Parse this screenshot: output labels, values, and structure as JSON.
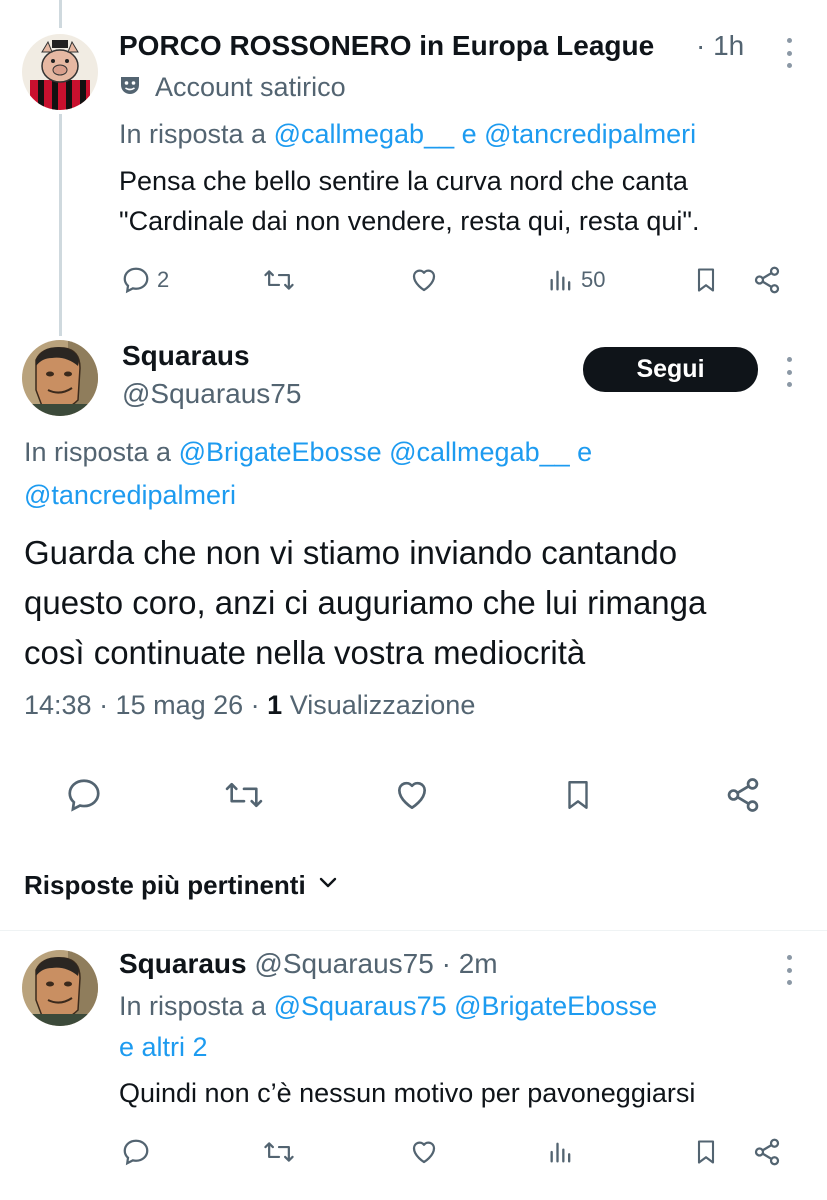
{
  "tweet1": {
    "name": "PORCO ROSSONERO in Europa League",
    "time": "· 1h",
    "label_text": "Account satirico",
    "reply_prefix": "In risposta a",
    "reply_mention1": "@callmegab__",
    "reply_and": "e",
    "reply_mention2": "@tancredipalmeri",
    "text_line1": "Pensa che bello sentire la curva nord che canta",
    "text_line2": "\"Cardinale dai non vendere, resta qui, resta qui\".",
    "replies": "2",
    "views": "50",
    "icons": [
      "reply-icon",
      "retweet-icon",
      "like-icon",
      "views-icon",
      "bookmark-icon",
      "share-icon"
    ]
  },
  "tweet2": {
    "name": "Squaraus",
    "handle": "@Squaraus75",
    "follow_label": "Segui",
    "reply_prefix": "In risposta a",
    "reply_mention1": "@BrigateEbosse",
    "reply_mention2": "@callmegab__",
    "reply_and": "e",
    "reply_mention3": "@tancredipalmeri",
    "text_line1": "Guarda che non vi stiamo inviando cantando",
    "text_line2": "questo coro, anzi ci auguriamo che lui rimanga",
    "text_line3": "così continuate nella vostra mediocrità",
    "meta_time": "14:38 · 15 mag 26 ·",
    "meta_count": "1",
    "meta_label": "Visualizzazione"
  },
  "sort": {
    "label": "Risposte più pertinenti"
  },
  "tweet3": {
    "name": "Squaraus",
    "handle": "@Squaraus75",
    "time": "· 2m",
    "reply_prefix": "In risposta a",
    "reply_mention1": "@Squaraus75",
    "reply_mention2": "@BrigateEbosse",
    "reply_and_others": "e altri 2",
    "text_line1": "Quindi non c’è nessun motivo per pavoneggiarsi"
  },
  "colors": {
    "accent": "#1d9bf0",
    "text": "#0f1419",
    "secondary": "#536471",
    "button_bg": "#0f1419"
  }
}
